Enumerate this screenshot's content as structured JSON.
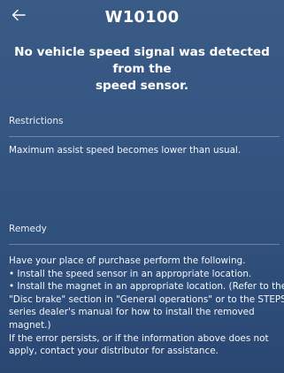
{
  "header": {
    "title": "W10100",
    "back_icon": "arrow-left-icon"
  },
  "headline": {
    "line1": "No vehicle speed signal was detected from the",
    "line2": "speed sensor."
  },
  "restrictions": {
    "label": "Restrictions",
    "text": "Maximum assist speed becomes lower than usual."
  },
  "remedy": {
    "label": "Remedy",
    "lines": [
      "Have your place of purchase perform the following.",
      "• Install the speed sensor in an appropriate location.",
      "• Install the magnet in an appropriate location. (Refer to the",
      "\"Disc brake\" section in \"General operations\" or to the STEPS",
      "series dealer's manual for how to install the removed",
      "magnet.)",
      "If the error persists, or if the information above does not",
      "apply, contact your distributor for assistance."
    ]
  }
}
